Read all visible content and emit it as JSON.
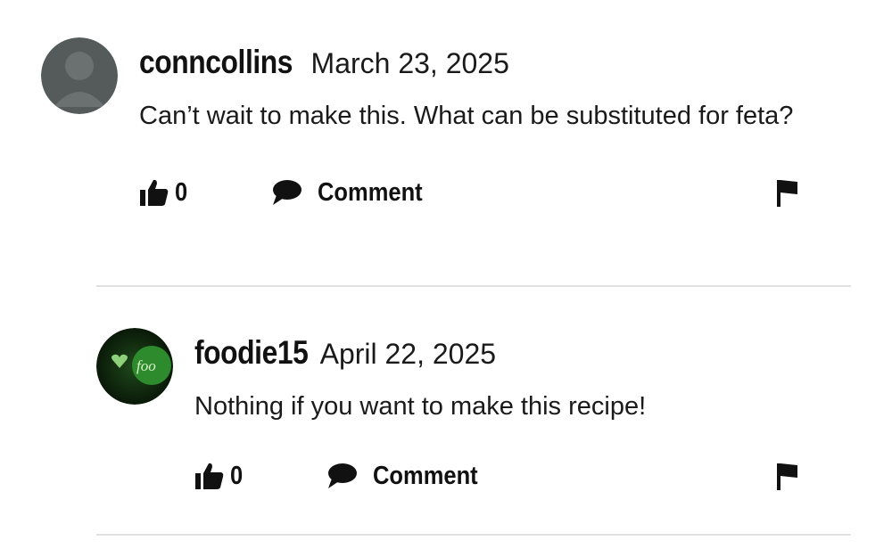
{
  "comments": [
    {
      "username": "conncollins",
      "date": "March 23, 2025",
      "text": "Can’t wait to make this. What can be substituted for feta?",
      "likes": "0",
      "comment_label": "Comment",
      "avatar_icon": "default-user-avatar"
    },
    {
      "username": "foodie15",
      "date": "April 22, 2025",
      "text": "Nothing if you want to make this recipe!",
      "likes": "0",
      "comment_label": "Comment",
      "avatar_icon": "food-network-avatar",
      "avatar_text": "foo"
    }
  ],
  "colors": {
    "text": "#111111",
    "divider": "#e0e0e0",
    "avatar_grey": "#5a5a5a",
    "avatar_green": "#0e2a0e",
    "heart_green": "#8fd07a"
  }
}
